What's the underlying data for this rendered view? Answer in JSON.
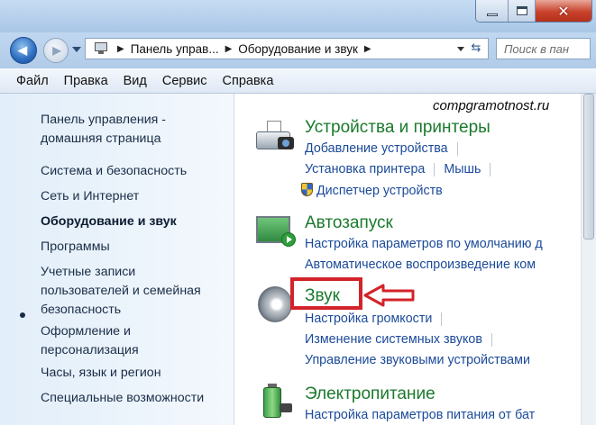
{
  "window": {
    "controls": {
      "minimize": "minimize-icon",
      "maximize": "maximize-icon",
      "close": "✕"
    }
  },
  "nav": {
    "back_icon": "◀",
    "forward_icon": "▶",
    "breadcrumbs": [
      "Панель управ...",
      "Оборудование и звук"
    ],
    "refresh_icon": "⇆",
    "search_placeholder": "Поиск в пан"
  },
  "menu": [
    "Файл",
    "Правка",
    "Вид",
    "Сервис",
    "Справка"
  ],
  "sidebar": {
    "items": [
      {
        "label": "Панель управления -\nдомашняя страница"
      },
      {
        "label": "Система и безопасность"
      },
      {
        "label": "Сеть и Интернет"
      },
      {
        "label": "Оборудование и звук",
        "active": true
      },
      {
        "label": "Программы"
      },
      {
        "label": "Учетные записи\nпользователей и семейная\nбезопасность"
      },
      {
        "label": "Оформление и\nперсонализация"
      },
      {
        "label": "Часы, язык и регион"
      },
      {
        "label": "Специальные возможности"
      }
    ]
  },
  "watermark": "compgramotnost.ru",
  "categories": [
    {
      "title": "Устройства и принтеры",
      "icon": "printer-icon",
      "links": [
        [
          "Добавление устройства"
        ],
        [
          "Установка принтера",
          "Мышь"
        ],
        [
          "Диспетчер устройств"
        ]
      ]
    },
    {
      "title": "Автозапуск",
      "icon": "autoplay-icon",
      "links": [
        [
          "Настройка параметров по умолчанию д"
        ],
        [
          "Автоматическое воспроизведение ком"
        ]
      ]
    },
    {
      "title": "Звук",
      "icon": "speaker-icon",
      "links": [
        [
          "Настройка громкости"
        ],
        [
          "Изменение системных звуков"
        ],
        [
          "Управление звуковыми устройствами"
        ]
      ]
    },
    {
      "title": "Электропитание",
      "icon": "battery-icon",
      "links": [
        [
          "Настройка параметров питания от бат"
        ]
      ]
    }
  ],
  "colors": {
    "highlight": "#d3232a",
    "category_title": "#1a7a2c",
    "link": "#1b4a9a"
  }
}
